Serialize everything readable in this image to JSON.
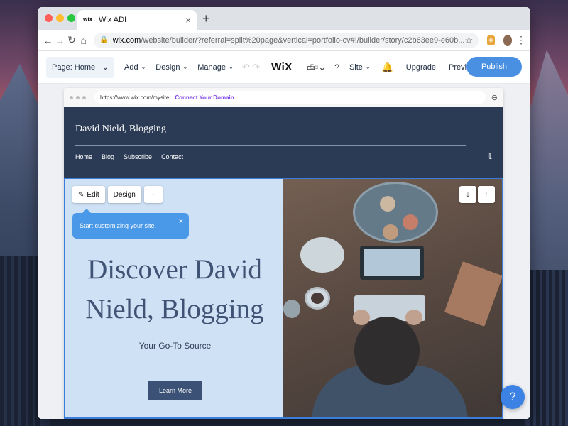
{
  "browser": {
    "tab_favicon": "WiX",
    "tab_title": "Wix ADI",
    "tab_close": "×",
    "new_tab": "+",
    "url_host": "wix.com",
    "url_rest": "/website/builder/?referral=split%20page&vertical=portfolio-cv#!/builder/story/c2b63ee9-e60b...",
    "icons": {
      "back": "←",
      "forward": "→",
      "reload": "↻",
      "home": "⌂",
      "lock": "🔒",
      "star": "☆",
      "ext": "◈",
      "menu": "⋮"
    }
  },
  "wix_toolbar": {
    "page_select": "Page: Home",
    "menus": [
      "Add",
      "Design",
      "Manage"
    ],
    "logo": "WiX",
    "device_label": "Sa",
    "help": "?",
    "site_menu": "Site",
    "upgrade": "Upgrade",
    "preview": "Preview",
    "publish": "Publish"
  },
  "site_browser": {
    "url": "https://www.wix.com/mysite",
    "connect": "Connect Your Domain"
  },
  "site": {
    "title": "David Nield, Blogging",
    "nav": [
      "Home",
      "Blog",
      "Subscribe",
      "Contact"
    ],
    "twitter_icon": "🐦",
    "hero_heading": "Discover David Nield, Blogging",
    "hero_sub": "Your Go-To Source",
    "cta": "Learn More"
  },
  "editor": {
    "edit": "Edit",
    "design": "Design",
    "more": "⋮",
    "tooltip": "Start customizing your site.",
    "tooltip_close": "×",
    "move_down": "↓",
    "move_up": "↑",
    "help_fab": "?"
  },
  "colors": {
    "header_bg": "#2b3a55",
    "hero_left_bg": "#cfe1f5",
    "accent_blue": "#4a90e2",
    "cta_bg": "#3b5176"
  }
}
